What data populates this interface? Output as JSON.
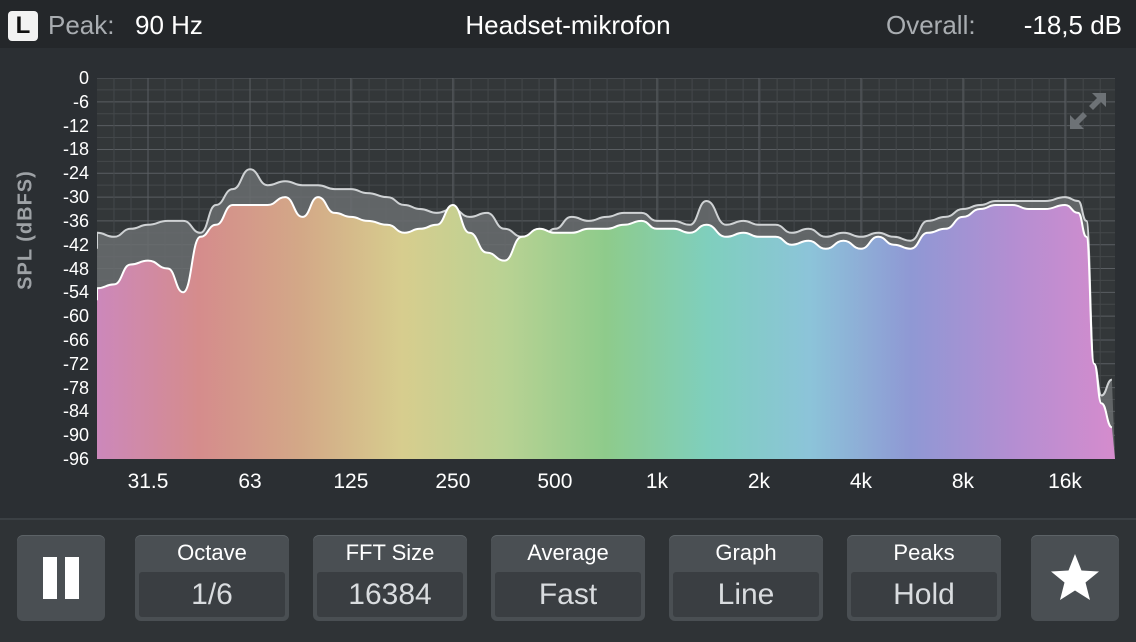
{
  "header": {
    "channel": "L",
    "peak_label": "Peak:",
    "peak_value": "90 Hz",
    "title": "Headset-mikrofon",
    "overall_label": "Overall:",
    "overall_value": "-18,5 dB"
  },
  "chart_data": {
    "type": "area",
    "ylabel": "SPL (dBFS)",
    "y_ticks": [
      "0",
      "-6",
      "-12",
      "-18",
      "-24",
      "-30",
      "-36",
      "-42",
      "-48",
      "-54",
      "-60",
      "-66",
      "-72",
      "-78",
      "-84",
      "-90",
      "-96"
    ],
    "x_ticks": [
      "31.5",
      "63",
      "125",
      "250",
      "500",
      "1k",
      "2k",
      "4k",
      "8k",
      "16k"
    ],
    "x_scale": "log",
    "ylim": [
      -96,
      0
    ],
    "grid": true,
    "series": [
      {
        "role": "peak-hold",
        "color": "#6a6d70",
        "x": [
          20,
          22,
          25,
          28,
          31.5,
          36,
          40,
          45,
          50,
          56,
          63,
          71,
          80,
          90,
          100,
          112,
          125,
          140,
          160,
          180,
          200,
          224,
          250,
          280,
          315,
          355,
          400,
          450,
          500,
          560,
          630,
          710,
          800,
          900,
          1000,
          1120,
          1250,
          1400,
          1600,
          1800,
          2000,
          2240,
          2500,
          2800,
          3150,
          3550,
          4000,
          4500,
          5000,
          5600,
          6300,
          7100,
          8000,
          9000,
          10000,
          11200,
          12500,
          14000,
          16000,
          17500,
          18500,
          19500,
          20500,
          22000
        ],
        "y": [
          -43,
          -39,
          -40,
          -38,
          -37,
          -36,
          -36,
          -39,
          -32,
          -28,
          -23,
          -27,
          -26,
          -27,
          -27,
          -28,
          -28,
          -29,
          -30,
          -32,
          -33,
          -34,
          -33,
          -35,
          -34,
          -38,
          -40,
          -41,
          -38,
          -35,
          -36,
          -35,
          -34,
          -34,
          -36,
          -36,
          -37,
          -31,
          -37,
          -36,
          -37,
          -37,
          -39,
          -38,
          -40,
          -39,
          -40,
          -39,
          -40,
          -41,
          -36,
          -35,
          -33,
          -32,
          -31,
          -31,
          -31,
          -31,
          -30,
          -31,
          -36,
          -72,
          -80,
          -76
        ]
      },
      {
        "role": "current",
        "gradient": [
          "#cc88bb",
          "#d58c8c",
          "#d3a887",
          "#d7cd8e",
          "#b9d293",
          "#8ecb8b",
          "#7fcfbd",
          "#8cc4d9",
          "#8f98d4",
          "#b48ed2",
          "#d58ccd"
        ],
        "x": [
          20,
          22,
          25,
          28,
          31.5,
          36,
          40,
          45,
          50,
          56,
          63,
          71,
          80,
          90,
          100,
          112,
          125,
          140,
          160,
          180,
          200,
          224,
          250,
          280,
          315,
          355,
          400,
          450,
          500,
          560,
          630,
          710,
          800,
          900,
          1000,
          1120,
          1250,
          1400,
          1600,
          1800,
          2000,
          2240,
          2500,
          2800,
          3150,
          3550,
          4000,
          4500,
          5000,
          5600,
          6300,
          7100,
          8000,
          9000,
          10000,
          11200,
          12500,
          14000,
          16000,
          17500,
          18500,
          19500,
          20500,
          22000
        ],
        "y": [
          -56,
          -53,
          -52,
          -47,
          -46,
          -48,
          -54,
          -40,
          -37,
          -32,
          -32,
          -32,
          -30,
          -35,
          -30,
          -34,
          -35,
          -36,
          -37,
          -39,
          -38,
          -37,
          -32,
          -39,
          -44,
          -46,
          -40,
          -38,
          -39,
          -39,
          -38,
          -38,
          -37,
          -36,
          -38,
          -38,
          -39,
          -37,
          -40,
          -39,
          -40,
          -40,
          -42,
          -41,
          -43,
          -41,
          -43,
          -40,
          -42,
          -43,
          -39,
          -38,
          -35,
          -33,
          -32,
          -32,
          -33,
          -33,
          -32,
          -34,
          -40,
          -72,
          -82,
          -88
        ]
      }
    ]
  },
  "controls": {
    "pause_icon": "pause-icon",
    "octave_label": "Octave",
    "octave_value": "1/6",
    "fft_label": "FFT Size",
    "fft_value": "16384",
    "average_label": "Average",
    "average_value": "Fast",
    "graph_label": "Graph",
    "graph_value": "Line",
    "peaks_label": "Peaks",
    "peaks_value": "Hold",
    "favorite_icon": "star-icon"
  }
}
